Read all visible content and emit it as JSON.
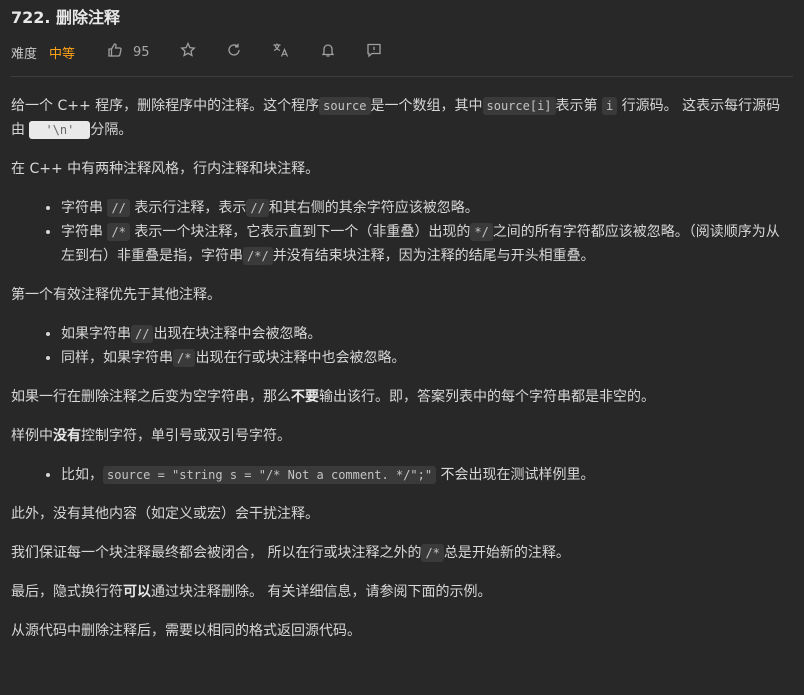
{
  "header": {
    "title": "722. 删除注释",
    "difficulty_label": "难度",
    "difficulty": "中等",
    "likes": "95",
    "icons": [
      "thumbs-up-icon",
      "star-icon",
      "refresh-icon",
      "translate-icon",
      "bell-icon",
      "feedback-icon"
    ],
    "colors": {
      "difficulty": "#ffa116",
      "background": "#282828",
      "text": "#d7d7d7"
    }
  },
  "p1": {
    "a": "给一个 C++ 程序，删除程序中的注释。这个程序",
    "code1": "source",
    "b": "是一个数组，其中",
    "code2": "source[i]",
    "c": "表示第",
    "code3": "i",
    "d": "行源码。 这表示每行源码由",
    "code4": "'\\n'",
    "e": "分隔。"
  },
  "p2": {
    "text": "在 C++ 中有两种注释风格，行内注释和块注释。"
  },
  "list1": {
    "item1": {
      "a": "字符串",
      "code1": "//",
      "b": "表示行注释，表示",
      "code2": "//",
      "c": "和其右侧的其余字符应该被忽略。"
    },
    "item2": {
      "a": "字符串",
      "code1": "/*",
      "b": "表示一个块注释，它表示直到下一个（非重叠）出现的",
      "code2": "*/",
      "c": "之间的所有字符都应该被忽略。（阅读顺序为从左到右）非重叠是指，字符串",
      "code3": "/*/",
      "d": "并没有结束块注释，因为注释的结尾与开头相重叠。"
    }
  },
  "p3": {
    "text": "第一个有效注释优先于其他注释。"
  },
  "list2": {
    "item1": {
      "a": "如果字符串",
      "code1": "//",
      "b": "出现在块注释中会被忽略。"
    },
    "item2": {
      "a": "同样，如果字符串",
      "code1": "/*",
      "b": "出现在行或块注释中也会被忽略。"
    }
  },
  "p4": {
    "a": "如果一行在删除注释之后变为空字符串，那么",
    "bold": "不要",
    "b": "输出该行。即，答案列表中的每个字符串都是非空的。"
  },
  "p5": {
    "a": "样例中",
    "bold": "没有",
    "b": "控制字符，单引号或双引号字符。"
  },
  "list3": {
    "item1": {
      "a": "比如，",
      "code1": "source = \"string s = \"/* Not a comment. */\";\"",
      "b": " 不会出现在测试样例里。"
    }
  },
  "p6": {
    "text": "此外，没有其他内容（如定义或宏）会干扰注释。"
  },
  "p7": {
    "a": "我们保证每一个块注释最终都会被闭合， 所以在行或块注释之外的",
    "code1": "/*",
    "b": "总是开始新的注释。"
  },
  "p8": {
    "a": "最后，隐式换行符",
    "bold": "可以",
    "b": "通过块注释删除。 有关详细信息，请参阅下面的示例。"
  },
  "p9": {
    "text": "从源代码中删除注释后，需要以相同的格式返回源代码。"
  }
}
